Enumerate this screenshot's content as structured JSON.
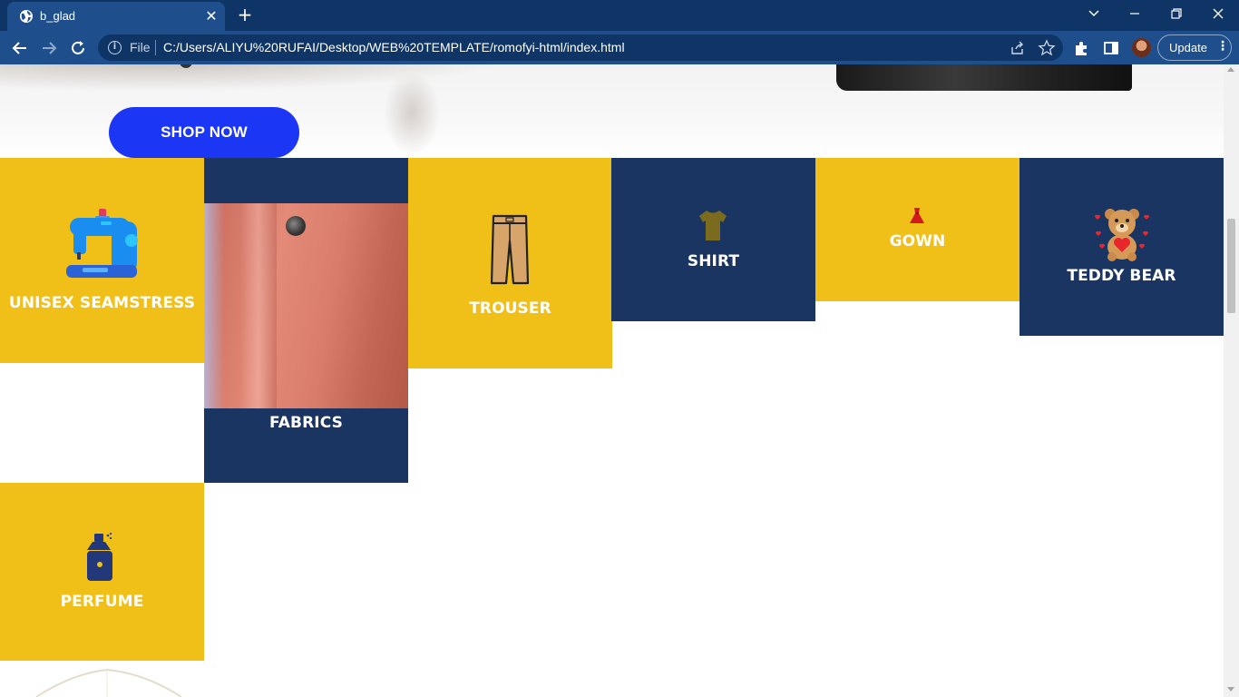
{
  "browser": {
    "tab_title": "b_glad",
    "tab_close_glyph": "✕",
    "new_tab_glyph": "+",
    "scheme_label": "File",
    "url": "C:/Users/ALIYU%20RUFAI/Desktop/WEB%20TEMPLATE/romofyi-html/index.html",
    "update_label": "Update",
    "icons": {
      "favicon": "globe-icon",
      "back": "back-arrow-icon",
      "forward": "forward-arrow-icon",
      "reload": "reload-icon",
      "info": "info-icon",
      "share": "share-icon",
      "bookmark": "star-icon",
      "extensions": "puzzle-icon",
      "side_panel": "side-panel-icon",
      "menu": "kebab-menu-icon",
      "tab_search": "chevron-down-icon",
      "minimize": "minimize-icon",
      "restore": "restore-icon",
      "close": "close-icon"
    },
    "colors": {
      "tabbar": "#0f3566",
      "toolbar": "#1e4f8c"
    }
  },
  "hero": {
    "shop_button": "SHOP NOW",
    "button_color": "#1c36f5"
  },
  "categories": [
    {
      "label": "UNISEX SEAMSTRESS",
      "icon": "sewing-machine-icon",
      "color": "#f0c019"
    },
    {
      "label": "FABRICS",
      "icon": "fabric-photo",
      "color": "#1a3562"
    },
    {
      "label": "TROUSER",
      "icon": "trouser-icon",
      "color": "#f0c019"
    },
    {
      "label": "SHIRT",
      "icon": "shirt-icon",
      "color": "#1a3562"
    },
    {
      "label": "GOWN",
      "icon": "gown-icon",
      "color": "#f0c019"
    },
    {
      "label": "TEDDY BEAR",
      "icon": "teddy-bear-icon",
      "color": "#1a3562"
    },
    {
      "label": "PERFUME",
      "icon": "perfume-icon",
      "color": "#f0c019"
    }
  ]
}
